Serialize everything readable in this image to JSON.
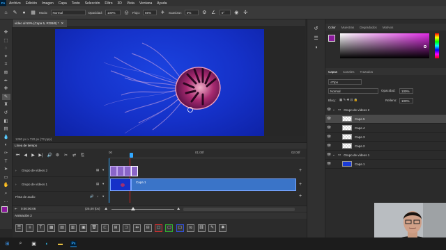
{
  "app": {
    "logo_text": "Ps"
  },
  "menu": [
    "Archivo",
    "Edición",
    "Imagen",
    "Capa",
    "Texto",
    "Selección",
    "Filtro",
    "3D",
    "Vista",
    "Ventana",
    "Ayuda"
  ],
  "options": {
    "modo_label": "Modo:",
    "modo_value": "Normal",
    "opacidad_label": "Opacidad:",
    "opacidad_value": "100%",
    "flujo_label": "Flujo:",
    "flujo_value": "55%",
    "suavizar_label": "Suavizar:",
    "suavizar_value": "0%",
    "angle_value": "0°"
  },
  "document": {
    "tab_title": "video al 50% (Capa 5, RGB/8) *",
    "status": "1280 px x 720 px (72 ppp)"
  },
  "timeline": {
    "title": "Línea de tiempo",
    "tracks": [
      {
        "label": "Grupo de vídeos 2"
      },
      {
        "label": "Grupo de vídeos 1",
        "clip_label": "Capa 1"
      },
      {
        "label": "Pista de audio"
      }
    ],
    "ruler": [
      "00",
      "01:00f",
      "02:00f"
    ],
    "timecode": "0:00:00:06",
    "fps": "(25,00 fps)"
  },
  "animation": {
    "title": "Animación 2"
  },
  "color_panel": {
    "tabs": [
      "Color",
      "Muestras",
      "Degradados",
      "Motivos"
    ]
  },
  "layers_panel": {
    "tabs": [
      "Capas",
      "Canales",
      "Trazados"
    ],
    "filter_value": "Tipo",
    "blend_mode": "Normal",
    "opacity_label": "Opacidad:",
    "opacity_value": "100%",
    "lock_label": "Bloq.:",
    "fill_label": "Relleno:",
    "fill_value": "100%",
    "layers": [
      {
        "name": "Grupo de vídeos 2",
        "kind": "group"
      },
      {
        "name": "Capa 5",
        "kind": "layer",
        "selected": true
      },
      {
        "name": "Capa 4",
        "kind": "layer"
      },
      {
        "name": "Capa 3",
        "kind": "layer"
      },
      {
        "name": "Capa 2",
        "kind": "layer"
      },
      {
        "name": "Grupo de vídeos 1",
        "kind": "group"
      },
      {
        "name": "Capa 1",
        "kind": "layer"
      }
    ]
  },
  "colors": {
    "accent": "#31a8ff",
    "purple_clip": "#8a65c8",
    "blue_clip": "#3a74c8",
    "playhead": "#d02020"
  },
  "taskbar": {
    "icons": [
      "windows-icon",
      "search-icon",
      "taskview-icon",
      "edge-icon",
      "explorer-icon",
      "photoshop-icon"
    ]
  }
}
